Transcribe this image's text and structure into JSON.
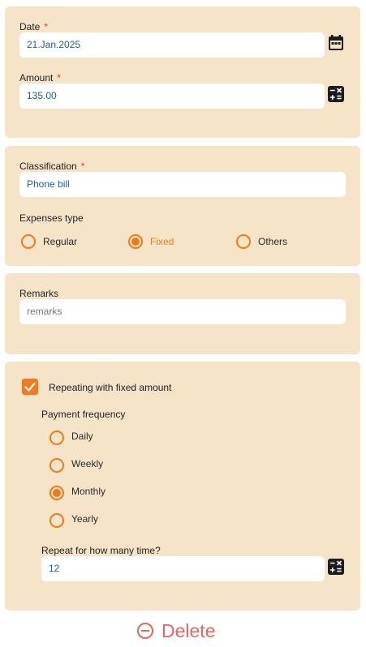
{
  "date": {
    "label": "Date",
    "required_mark": "*",
    "value": "21.Jan.2025",
    "icon": "calendar-icon"
  },
  "amount": {
    "label": "Amount",
    "required_mark": "*",
    "value": "135.00",
    "icon": "calculator-icon"
  },
  "classification": {
    "label": "Classification",
    "required_mark": "*",
    "value": "Phone bill"
  },
  "expenses_type": {
    "label": "Expenses type",
    "options": [
      "Regular",
      "Fixed",
      "Others"
    ],
    "selected": "Fixed"
  },
  "remarks": {
    "label": "Remarks",
    "placeholder": "remarks"
  },
  "repeating": {
    "checkbox_label": "Repeating with fixed amount",
    "checked": true,
    "frequency_label": "Payment frequency",
    "frequency_options": [
      "Daily",
      "Weekly",
      "Monthly",
      "Yearly"
    ],
    "frequency_selected": "Monthly",
    "times_label": "Repeat for how many time?",
    "times_value": "12",
    "times_icon": "calculator-icon"
  },
  "delete": {
    "label": "Delete",
    "icon": "minus-circle-icon"
  },
  "colors": {
    "card_bg": "#f5e4c8",
    "accent": "#f47a1f",
    "value_text": "#1a5fa8",
    "danger": "#e5675e",
    "required": "#e53935"
  }
}
